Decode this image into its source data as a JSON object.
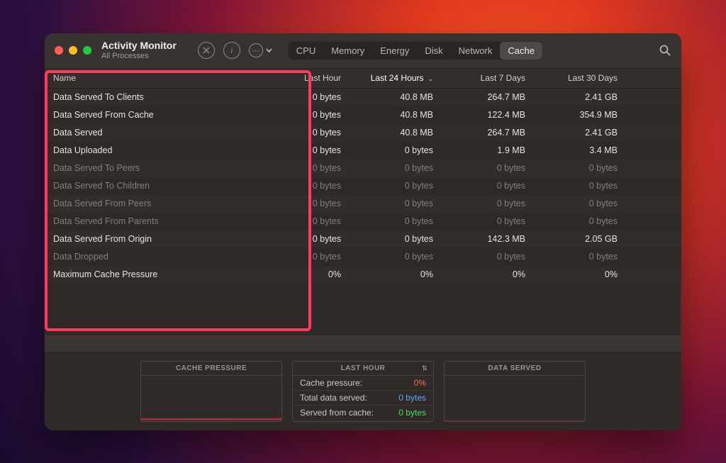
{
  "window": {
    "title": "Activity Monitor",
    "subtitle": "All Processes"
  },
  "tabs": [
    "CPU",
    "Memory",
    "Energy",
    "Disk",
    "Network",
    "Cache"
  ],
  "active_tab": "Cache",
  "columns": {
    "name": "Name",
    "c1": "Last Hour",
    "c2": "Last 24 Hours",
    "c3": "Last 7 Days",
    "c4": "Last 30 Days",
    "sorted": "c2"
  },
  "rows": [
    {
      "name": "Data Served To Clients",
      "dim": false,
      "v": [
        "0 bytes",
        "40.8 MB",
        "264.7 MB",
        "2.41 GB"
      ]
    },
    {
      "name": "Data Served From Cache",
      "dim": false,
      "v": [
        "0 bytes",
        "40.8 MB",
        "122.4 MB",
        "354.9 MB"
      ]
    },
    {
      "name": "Data Served",
      "dim": false,
      "v": [
        "0 bytes",
        "40.8 MB",
        "264.7 MB",
        "2.41 GB"
      ]
    },
    {
      "name": "Data Uploaded",
      "dim": false,
      "v": [
        "0 bytes",
        "0 bytes",
        "1.9 MB",
        "3.4 MB"
      ]
    },
    {
      "name": "Data Served To Peers",
      "dim": true,
      "v": [
        "0 bytes",
        "0 bytes",
        "0 bytes",
        "0 bytes"
      ]
    },
    {
      "name": "Data Served To Children",
      "dim": true,
      "v": [
        "0 bytes",
        "0 bytes",
        "0 bytes",
        "0 bytes"
      ]
    },
    {
      "name": "Data Served From Peers",
      "dim": true,
      "v": [
        "0 bytes",
        "0 bytes",
        "0 bytes",
        "0 bytes"
      ]
    },
    {
      "name": "Data Served From Parents",
      "dim": true,
      "v": [
        "0 bytes",
        "0 bytes",
        "0 bytes",
        "0 bytes"
      ]
    },
    {
      "name": "Data Served From Origin",
      "dim": false,
      "v": [
        "0 bytes",
        "0 bytes",
        "142.3 MB",
        "2.05 GB"
      ]
    },
    {
      "name": "Data Dropped",
      "dim": true,
      "v": [
        "0 bytes",
        "0 bytes",
        "0 bytes",
        "0 bytes"
      ]
    },
    {
      "name": "Maximum Cache Pressure",
      "dim": false,
      "v": [
        "0%",
        "0%",
        "0%",
        "0%"
      ]
    }
  ],
  "panels": {
    "left": {
      "title": "CACHE PRESSURE"
    },
    "mid": {
      "title": "LAST HOUR",
      "items": [
        {
          "k": "Cache pressure:",
          "v": "0%",
          "cls": "red"
        },
        {
          "k": "Total data served:",
          "v": "0 bytes",
          "cls": "blue"
        },
        {
          "k": "Served from cache:",
          "v": "0 bytes",
          "cls": "green"
        }
      ]
    },
    "right": {
      "title": "DATA SERVED"
    }
  }
}
